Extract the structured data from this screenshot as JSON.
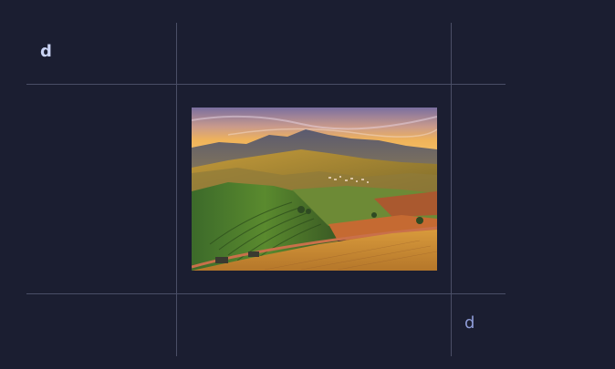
{
  "table": {
    "header_cell": "d",
    "footer_cell": "d"
  },
  "image": {
    "name": "landscape-photo",
    "description_icon": "vineyard-hills-photo"
  },
  "colors": {
    "background": "#1b1e31",
    "grid_line": "#4a4e66",
    "header_text": "#c9d3f3",
    "footer_text": "#8e9bd6"
  }
}
